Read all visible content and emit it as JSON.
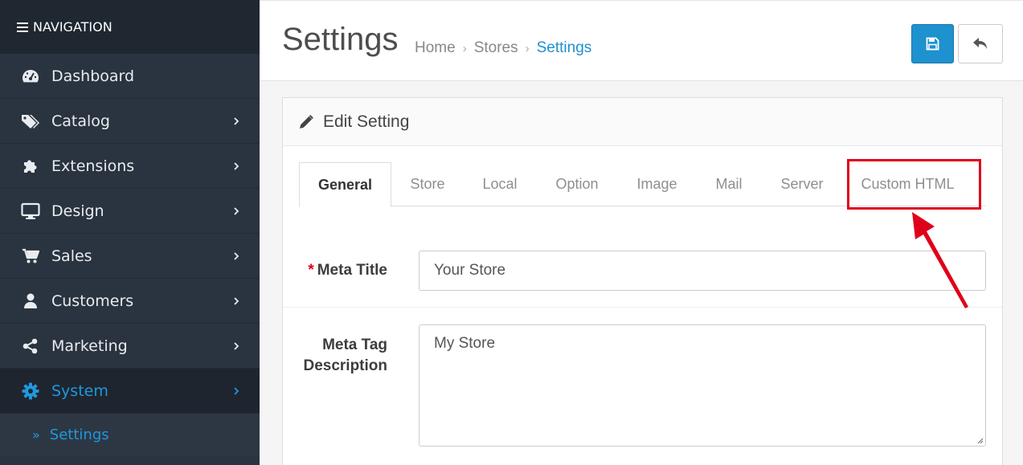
{
  "sidebar": {
    "header": "NAVIGATION",
    "items": [
      {
        "label": "Dashboard",
        "icon": "dashboard-icon"
      },
      {
        "label": "Catalog",
        "icon": "tags-icon"
      },
      {
        "label": "Extensions",
        "icon": "puzzle-icon"
      },
      {
        "label": "Design",
        "icon": "monitor-icon"
      },
      {
        "label": "Sales",
        "icon": "cart-icon"
      },
      {
        "label": "Customers",
        "icon": "user-icon"
      },
      {
        "label": "Marketing",
        "icon": "share-icon"
      },
      {
        "label": "System",
        "icon": "gear-icon"
      }
    ],
    "sub_item": "Settings"
  },
  "header": {
    "title": "Settings",
    "breadcrumb": [
      "Home",
      "Stores",
      "Settings"
    ]
  },
  "panel": {
    "title": "Edit Setting",
    "tabs": [
      "General",
      "Store",
      "Local",
      "Option",
      "Image",
      "Mail",
      "Server",
      "Custom HTML"
    ]
  },
  "form": {
    "meta_title_label": "Meta Title",
    "meta_title_value": "Your Store",
    "meta_desc_label_1": "Meta Tag",
    "meta_desc_label_2": "Description",
    "meta_desc_value": "My Store"
  },
  "colors": {
    "accent": "#1e91cf",
    "highlight": "#e0001a",
    "sidebar_bg": "#2a3340"
  }
}
